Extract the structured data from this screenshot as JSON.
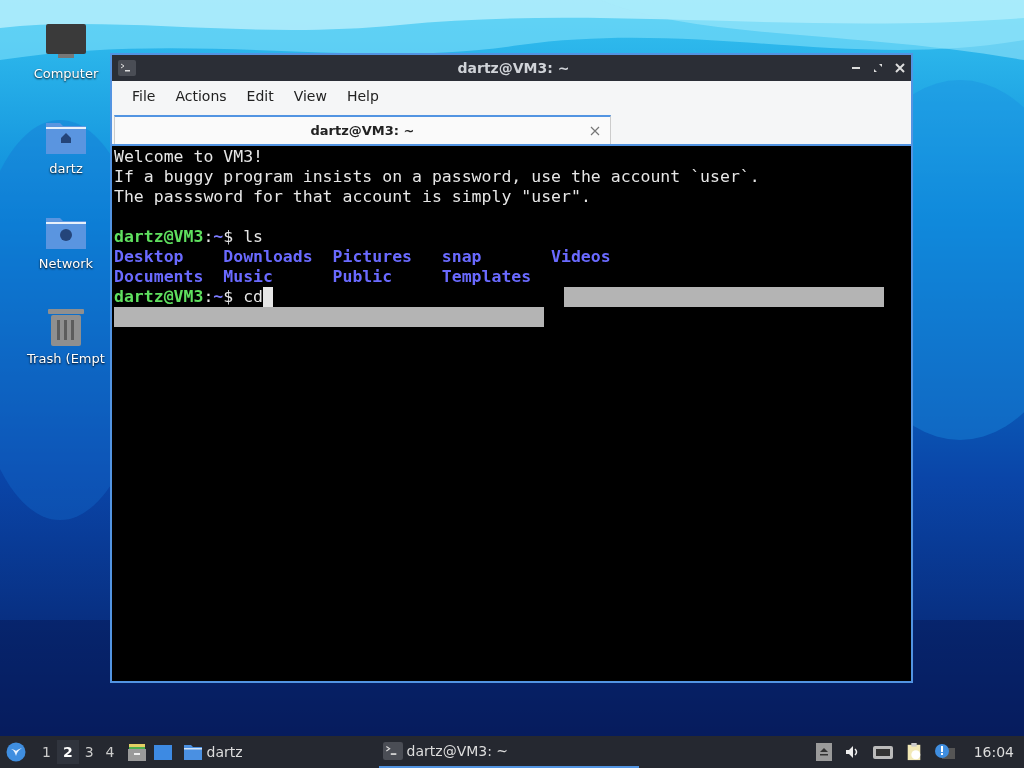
{
  "desktop_icons": [
    {
      "label": "Computer",
      "kind": "computer"
    },
    {
      "label": "dartz",
      "kind": "home"
    },
    {
      "label": "Network",
      "kind": "network"
    },
    {
      "label": "Trash (Empt",
      "kind": "trash"
    }
  ],
  "window": {
    "title": "dartz@VM3: ~",
    "menu": [
      "File",
      "Actions",
      "Edit",
      "View",
      "Help"
    ],
    "tabs": [
      {
        "label": "dartz@VM3: ~",
        "selected": true
      }
    ],
    "terminal": {
      "lines": [
        {
          "kind": "text",
          "text": "Welcome to VM3!"
        },
        {
          "kind": "text",
          "text": "If a buggy program insists on a password, use the account `user`."
        },
        {
          "kind": "text",
          "text": "The passsword for that account is simply \"user\"."
        },
        {
          "kind": "blank"
        },
        {
          "kind": "prompt",
          "cursor": false,
          "segments": [
            {
              "text": "dartz@VM3",
              "kind": "user"
            },
            {
              "text": ":",
              "kind": "plain"
            },
            {
              "text": "~",
              "kind": "path"
            },
            {
              "text": "$ ls",
              "kind": "plain"
            }
          ]
        },
        {
          "kind": "listing",
          "names": [
            "Desktop",
            "Downloads",
            "Pictures",
            "snap",
            "Videos"
          ]
        },
        {
          "kind": "listing",
          "names": [
            "Documents",
            "Music",
            "Public",
            "Templates"
          ]
        },
        {
          "kind": "prompt",
          "cursor": true,
          "segments": [
            {
              "text": "dartz@VM3",
              "kind": "user"
            },
            {
              "text": ":",
              "kind": "plain"
            },
            {
              "text": "~",
              "kind": "path"
            },
            {
              "text": "$ cd",
              "kind": "plain"
            }
          ]
        }
      ]
    }
  },
  "taskbar": {
    "workspaces": [
      {
        "label": "1",
        "selected": false
      },
      {
        "label": "2",
        "selected": true
      },
      {
        "label": "3",
        "selected": false
      },
      {
        "label": "4",
        "selected": false
      }
    ],
    "tasks": [
      {
        "label": "dartz",
        "kind": "folder",
        "selected": false
      },
      {
        "label": "dartz@VM3: ~",
        "kind": "terminal",
        "selected": true
      }
    ],
    "clock": "16:04"
  }
}
